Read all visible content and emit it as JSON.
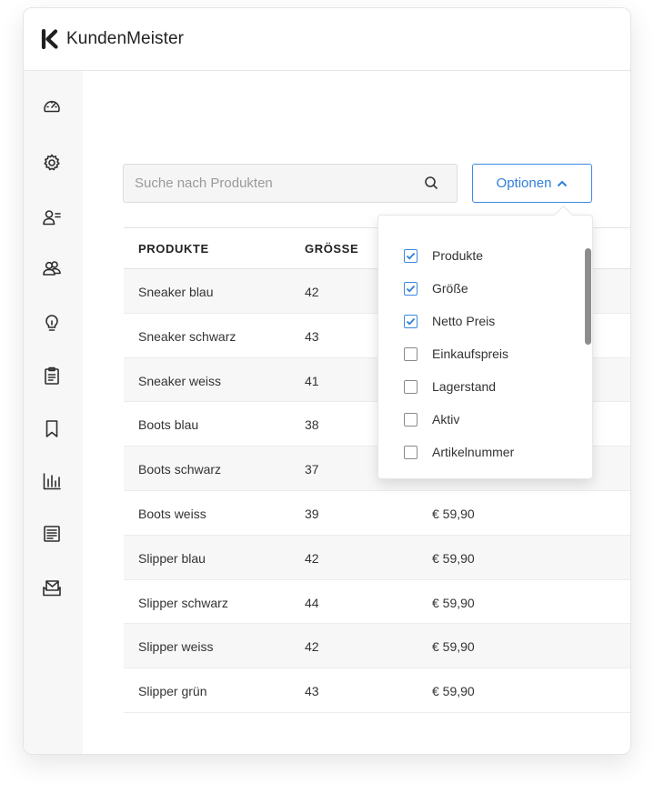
{
  "app": {
    "name": "KundenMeister"
  },
  "search": {
    "placeholder": "Suche nach Produkten"
  },
  "options_button": {
    "label": "Optionen"
  },
  "table": {
    "headers": [
      "PRODUKTE",
      "GRÖSSE"
    ],
    "rows": [
      {
        "product": "Sneaker blau",
        "size": "42",
        "price": ""
      },
      {
        "product": "Sneaker schwarz",
        "size": "43",
        "price": ""
      },
      {
        "product": "Sneaker weiss",
        "size": "41",
        "price": ""
      },
      {
        "product": "Boots blau",
        "size": "38",
        "price": ""
      },
      {
        "product": "Boots schwarz",
        "size": "37",
        "price": ""
      },
      {
        "product": "Boots weiss",
        "size": "39",
        "price": "€ 59,90"
      },
      {
        "product": "Slipper blau",
        "size": "42",
        "price": "€ 59,90"
      },
      {
        "product": "Slipper schwarz",
        "size": "44",
        "price": "€ 59,90"
      },
      {
        "product": "Slipper weiss",
        "size": "42",
        "price": "€ 59,90"
      },
      {
        "product": "Slipper grün",
        "size": "43",
        "price": "€ 59,90"
      }
    ]
  },
  "options_menu": {
    "items": [
      {
        "label": "Produkte",
        "checked": true
      },
      {
        "label": "Größe",
        "checked": true
      },
      {
        "label": "Netto Preis",
        "checked": true
      },
      {
        "label": "Einkaufspreis",
        "checked": false
      },
      {
        "label": "Lagerstand",
        "checked": false
      },
      {
        "label": "Aktiv",
        "checked": false
      },
      {
        "label": "Artikelnummer",
        "checked": false
      }
    ]
  },
  "sidebar": {
    "icons": [
      "dashboard-icon",
      "settings-icon",
      "user-list-icon",
      "users-icon",
      "lightbulb-icon",
      "clipboard-icon",
      "bookmark-icon",
      "bar-chart-icon",
      "report-icon",
      "mail-icon"
    ]
  },
  "colors": {
    "accent": "#3b8ae0",
    "sidebar_bg": "#f7f7f7",
    "row_alt": "#f7f7f7"
  }
}
